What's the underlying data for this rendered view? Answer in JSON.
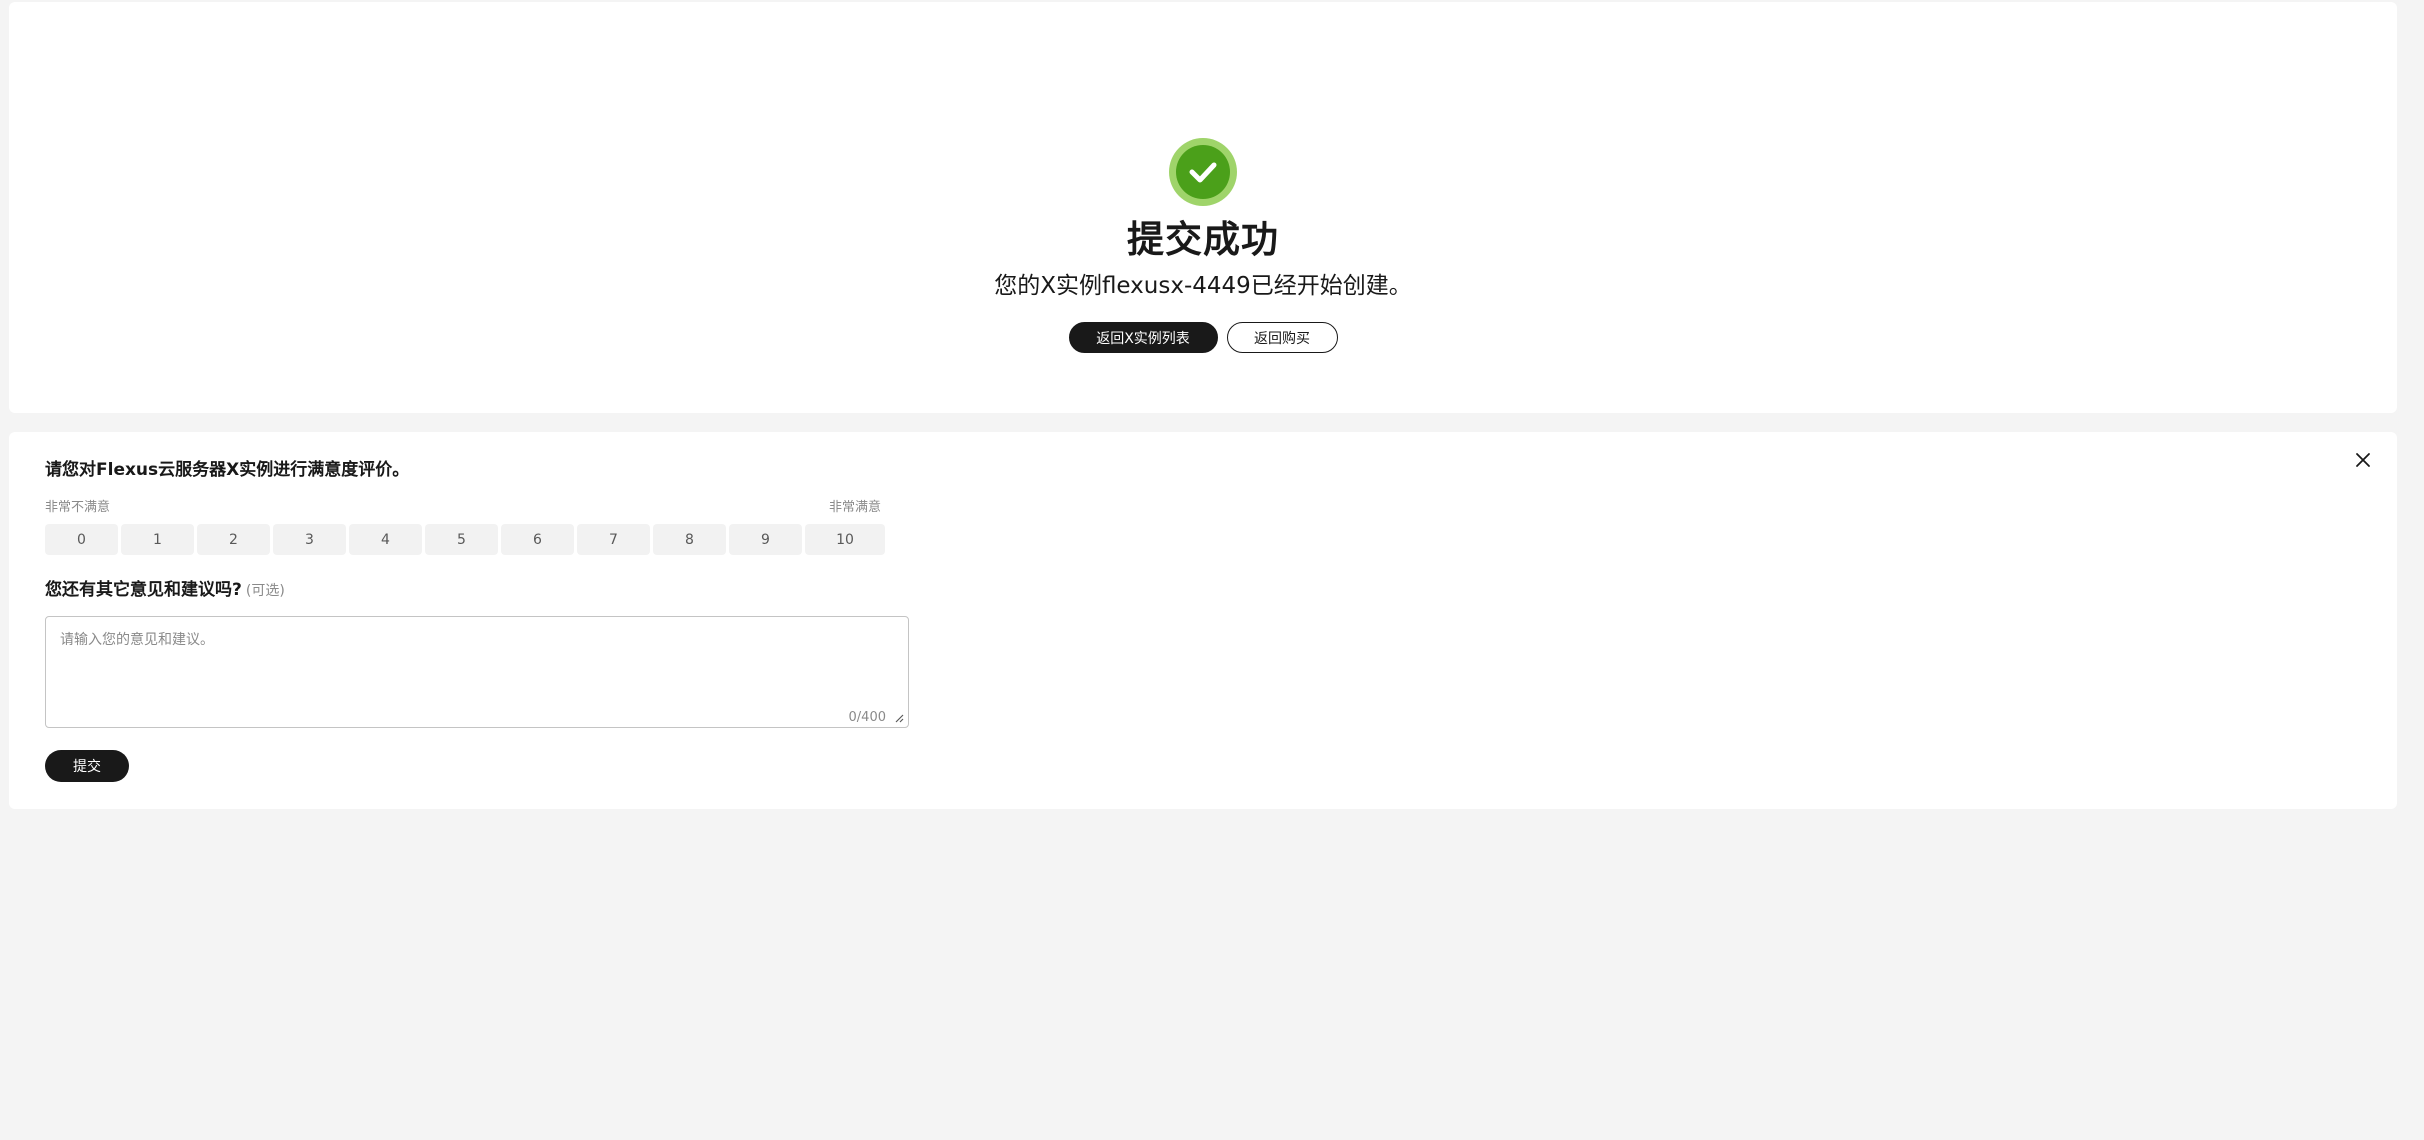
{
  "success": {
    "icon": "check-circle-icon",
    "title": "提交成功",
    "description": "您的X实例flexusx-4449已经开始创建。",
    "primary_button": "返回X实例列表",
    "secondary_button": "返回购买",
    "colors": {
      "check_outer": "#9fd46a",
      "check_inner": "#4ba01a"
    }
  },
  "survey": {
    "question": "请您对Flexus云服务器X实例进行满意度评价。",
    "scale_min_label": "非常不满意",
    "scale_max_label": "非常满意",
    "scale": [
      "0",
      "1",
      "2",
      "3",
      "4",
      "5",
      "6",
      "7",
      "8",
      "9",
      "10"
    ],
    "suggestion_label": "您还有其它意见和建议吗?",
    "suggestion_optional": "(可选)",
    "textarea_placeholder": "请输入您的意见和建议。",
    "textarea_value": "",
    "char_count": "0/400",
    "submit_label": "提交",
    "close_icon": "close-icon"
  }
}
